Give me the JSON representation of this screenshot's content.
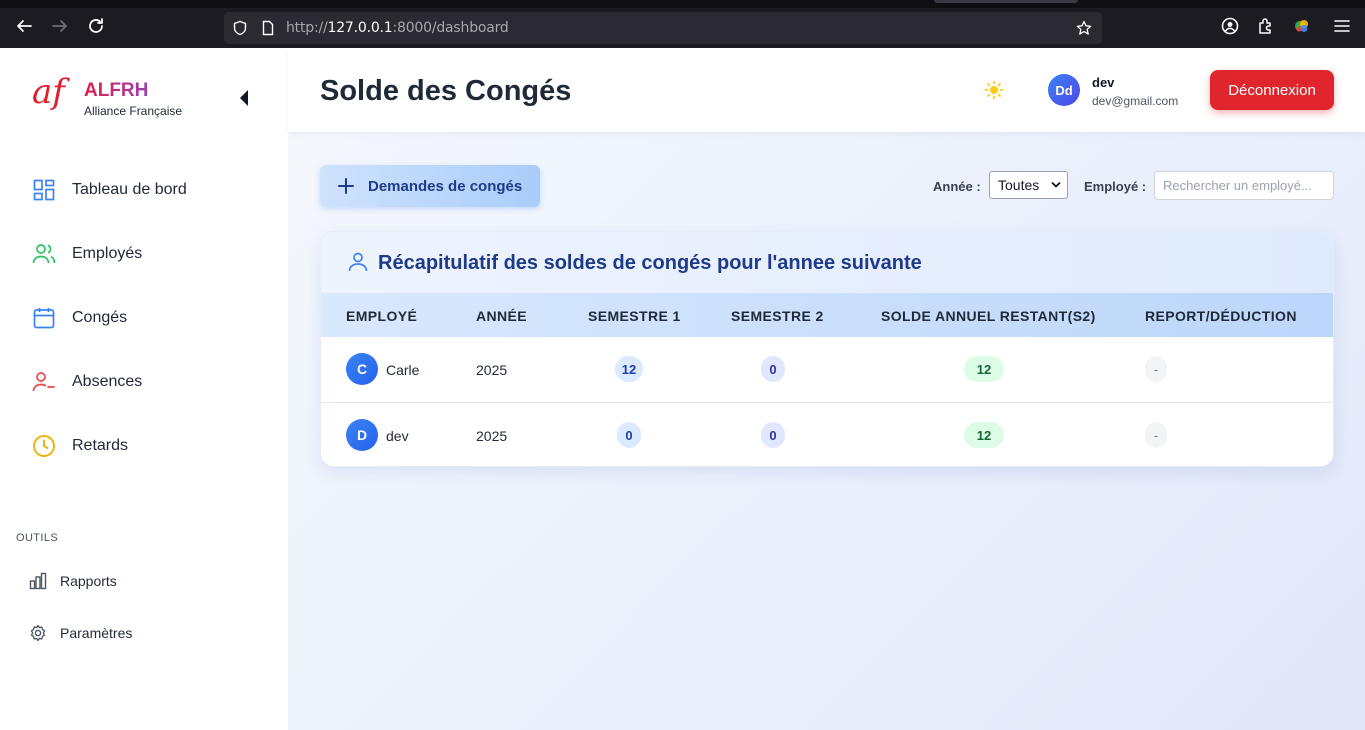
{
  "browser": {
    "url_prefix": "http://",
    "url_host": "127.0.0.1",
    "url_path": ":8000/dashboard"
  },
  "sidebar": {
    "logo_mark": "af",
    "brand_name": "ALFRH",
    "brand_sub": "Alliance Française",
    "nav": [
      {
        "label": "Tableau de bord",
        "icon": "grid-icon",
        "color": "#3b82f6"
      },
      {
        "label": "Employés",
        "icon": "users-icon",
        "color": "#22c55e"
      },
      {
        "label": "Congés",
        "icon": "calendar-icon",
        "color": "#3b82f6"
      },
      {
        "label": "Absences",
        "icon": "user-x-icon",
        "color": "#ef4444"
      },
      {
        "label": "Retards",
        "icon": "clock-icon",
        "color": "#eab308"
      }
    ],
    "tools_title": "OUTILS",
    "tools": [
      {
        "label": "Rapports",
        "icon": "bar-chart-icon"
      },
      {
        "label": "Paramètres",
        "icon": "gear-icon"
      }
    ]
  },
  "header": {
    "title": "Solde des Congés",
    "user_initials": "Dd",
    "user_name": "dev",
    "user_email": "dev@gmail.com",
    "logout_label": "Déconnexion"
  },
  "toolbar": {
    "request_label": "Demandes de congés",
    "year_label": "Année :",
    "year_value": "Toutes",
    "employee_label": "Employé :",
    "search_placeholder": "Rechercher un employé..."
  },
  "table": {
    "title": "Récapitulatif des soldes de congés pour l'annee suivante",
    "columns": [
      "EMPLOYÉ",
      "ANNÉE",
      "SEMESTRE 1",
      "SEMESTRE 2",
      "SOLDE ANNUEL RESTANT(S2)",
      "REPORT/DÉDUCTION"
    ],
    "rows": [
      {
        "initial": "C",
        "name": "Carle",
        "year": "2025",
        "s1": "12",
        "s2": "0",
        "remaining": "12",
        "report": "-"
      },
      {
        "initial": "D",
        "name": "dev",
        "year": "2025",
        "s1": "0",
        "s2": "0",
        "remaining": "12",
        "report": "-"
      }
    ]
  },
  "colors": {
    "brand": "#e11d2e",
    "logout": "#e0262c",
    "title_blue": "#1e3a8a"
  }
}
